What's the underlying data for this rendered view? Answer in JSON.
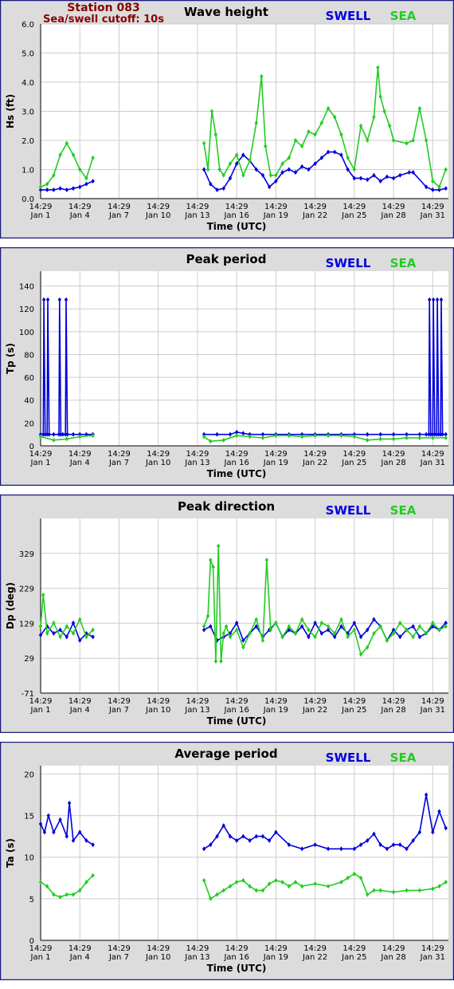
{
  "station": {
    "name": "Station 083",
    "cutoff": "Sea/swell cutoff: 10s",
    "color": "#8b0000"
  },
  "colors": {
    "swell": "#0000dd",
    "sea": "#22cc22",
    "frame": "#1a1a80",
    "panel_bg": "#dcdcdc",
    "grid": "#cccccc"
  },
  "time_axis": {
    "xlabel": "Time (UTC)",
    "tick_time": "14:29",
    "tick_days": [
      1,
      4,
      7,
      10,
      13,
      16,
      19,
      22,
      25,
      28,
      31
    ],
    "tick_dates": [
      "Jan 1",
      "Jan 4",
      "Jan 7",
      "Jan 10",
      "Jan 13",
      "Jan 16",
      "Jan 19",
      "Jan 22",
      "Jan 25",
      "Jan 28",
      "Jan 31"
    ],
    "xlim_days": [
      1,
      32.2
    ]
  },
  "chart_data": [
    {
      "type": "line",
      "title": "Wave height",
      "ylabel": "Hs (ft)",
      "ylim": [
        0,
        6
      ],
      "yticks": [
        "0.0",
        "1.0",
        "2.0",
        "3.0",
        "4.0",
        "5.0",
        "6.0"
      ],
      "grid": true,
      "legend": "top-right",
      "series": [
        {
          "name": "SWELL",
          "x": [
            1.0,
            1.5,
            2.0,
            2.5,
            3.0,
            3.5,
            4.0,
            4.5,
            5.0,
            13.5,
            14.0,
            14.5,
            15.0,
            15.5,
            16.0,
            16.5,
            17.0,
            17.5,
            18.0,
            18.5,
            19.0,
            19.5,
            20.0,
            20.5,
            21.0,
            21.5,
            22.0,
            22.5,
            23.0,
            23.5,
            24.0,
            24.5,
            25.0,
            25.5,
            26.0,
            26.5,
            27.0,
            27.5,
            28.0,
            28.5,
            29.2,
            29.5,
            30.5,
            31.0,
            31.5,
            32.0
          ],
          "y": [
            0.3,
            0.3,
            0.3,
            0.35,
            0.3,
            0.35,
            0.4,
            0.5,
            0.6,
            1.0,
            0.5,
            0.3,
            0.35,
            0.7,
            1.2,
            1.5,
            1.3,
            1.0,
            0.8,
            0.4,
            0.6,
            0.9,
            1.0,
            0.9,
            1.1,
            1.0,
            1.2,
            1.4,
            1.6,
            1.6,
            1.5,
            1.0,
            0.7,
            0.7,
            0.65,
            0.8,
            0.6,
            0.75,
            0.7,
            0.8,
            0.9,
            0.9,
            0.4,
            0.3,
            0.3,
            0.35
          ]
        },
        {
          "name": "SEA",
          "x": [
            1.0,
            1.5,
            2.0,
            2.5,
            3.0,
            3.5,
            4.0,
            4.5,
            5.0,
            13.5,
            13.8,
            14.1,
            14.4,
            14.7,
            15.0,
            15.5,
            16.0,
            16.5,
            17.0,
            17.5,
            17.9,
            18.2,
            18.6,
            19.0,
            19.5,
            20.0,
            20.5,
            21.0,
            21.5,
            22.0,
            22.5,
            23.0,
            23.5,
            24.0,
            24.5,
            25.0,
            25.5,
            26.0,
            26.5,
            26.8,
            27.0,
            27.3,
            27.7,
            28.0,
            29.0,
            29.5,
            30.0,
            30.5,
            31.0,
            31.5,
            32.0
          ],
          "y": [
            0.4,
            0.5,
            0.8,
            1.5,
            1.9,
            1.5,
            1.0,
            0.7,
            1.4,
            1.9,
            1.0,
            3.0,
            2.2,
            1.0,
            0.8,
            1.2,
            1.5,
            0.8,
            1.3,
            2.6,
            4.2,
            1.8,
            0.8,
            0.8,
            1.2,
            1.4,
            2.0,
            1.8,
            2.3,
            2.2,
            2.6,
            3.1,
            2.8,
            2.2,
            1.4,
            1.0,
            2.5,
            2.0,
            2.8,
            4.5,
            3.5,
            3.0,
            2.5,
            2.0,
            1.9,
            2.0,
            3.1,
            2.0,
            0.6,
            0.4,
            1.0
          ]
        }
      ]
    },
    {
      "type": "line",
      "title": "Peak period",
      "ylabel": "Tp (s)",
      "ylim": [
        0,
        153
      ],
      "yticks": [
        "0",
        "20",
        "40",
        "60",
        "80",
        "100",
        "120",
        "140"
      ],
      "grid": true,
      "legend": "top-right",
      "series": [
        {
          "name": "SWELL",
          "x": [
            1.0,
            1.2,
            1.25,
            1.35,
            1.5,
            1.55,
            1.65,
            2.0,
            2.4,
            2.45,
            2.55,
            2.7,
            2.9,
            2.95,
            3.05,
            3.5,
            4.0,
            4.5,
            5.0,
            13.5,
            14.5,
            15.5,
            16.0,
            16.5,
            17.0,
            18.0,
            19.0,
            20.0,
            21.0,
            22.0,
            23.0,
            24.0,
            25.0,
            26.0,
            27.0,
            28.0,
            29.0,
            30.0,
            30.5,
            30.7,
            30.75,
            30.85,
            31.0,
            31.05,
            31.15,
            31.3,
            31.35,
            31.45,
            31.6,
            31.65,
            31.75,
            32.0
          ],
          "y": [
            10,
            10,
            128,
            10,
            10,
            128,
            10,
            10,
            10,
            128,
            10,
            10,
            10,
            128,
            10,
            10,
            10,
            10,
            10,
            10,
            10,
            10,
            12,
            11,
            10,
            10,
            10,
            10,
            10,
            10,
            10,
            10,
            10,
            10,
            10,
            10,
            10,
            10,
            10,
            10,
            128,
            10,
            10,
            128,
            10,
            10,
            128,
            10,
            10,
            128,
            10,
            10
          ]
        },
        {
          "name": "SEA",
          "x": [
            1.0,
            2.0,
            3.0,
            4.0,
            5.0,
            13.5,
            14.0,
            15.0,
            16.0,
            17.0,
            18.0,
            19.0,
            20.0,
            21.0,
            22.0,
            23.0,
            24.0,
            25.0,
            26.0,
            27.0,
            28.0,
            29.0,
            30.0,
            31.0,
            32.0
          ],
          "y": [
            8,
            5,
            6,
            8,
            9,
            8,
            4,
            5,
            9,
            8,
            7,
            9,
            9,
            8,
            9,
            9,
            9,
            8,
            5,
            6,
            6,
            7,
            7,
            7,
            7
          ]
        }
      ]
    },
    {
      "type": "line",
      "title": "Peak direction",
      "ylabel": "Dp (deg)",
      "ylim": [
        -71,
        429
      ],
      "yticks": [
        "-71",
        "29",
        "129",
        "229",
        "329"
      ],
      "grid": true,
      "legend": "top-right",
      "series": [
        {
          "name": "SWELL",
          "x": [
            1.0,
            1.5,
            2.0,
            2.5,
            3.0,
            3.5,
            4.0,
            4.5,
            5.0,
            13.5,
            14.0,
            14.5,
            15.0,
            15.5,
            16.0,
            16.5,
            17.0,
            17.5,
            18.0,
            18.5,
            19.0,
            19.5,
            20.0,
            20.5,
            21.0,
            21.5,
            22.0,
            22.5,
            23.0,
            23.5,
            24.0,
            24.5,
            25.0,
            25.5,
            26.0,
            26.5,
            27.0,
            27.5,
            28.0,
            28.5,
            29.0,
            29.5,
            30.0,
            30.5,
            31.0,
            31.5,
            32.0
          ],
          "y": [
            95,
            120,
            100,
            110,
            90,
            130,
            80,
            100,
            90,
            110,
            120,
            80,
            90,
            100,
            130,
            80,
            100,
            120,
            90,
            110,
            130,
            90,
            110,
            100,
            120,
            90,
            130,
            100,
            110,
            90,
            120,
            100,
            130,
            90,
            110,
            140,
            120,
            80,
            110,
            90,
            110,
            120,
            90,
            100,
            120,
            110,
            130
          ]
        },
        {
          "name": "SEA",
          "x": [
            1.0,
            1.2,
            1.5,
            2.0,
            2.5,
            3.0,
            3.5,
            4.0,
            4.5,
            5.0,
            13.5,
            13.8,
            14.0,
            14.2,
            14.4,
            14.6,
            14.8,
            15.0,
            15.2,
            15.5,
            16.0,
            16.5,
            17.0,
            17.5,
            18.0,
            18.3,
            18.6,
            19.0,
            19.5,
            20.0,
            20.5,
            21.0,
            21.5,
            22.0,
            22.5,
            23.0,
            23.5,
            24.0,
            24.5,
            25.0,
            25.5,
            26.0,
            26.5,
            27.0,
            27.5,
            28.0,
            28.5,
            29.0,
            29.5,
            30.0,
            30.5,
            31.0,
            31.5,
            32.0
          ],
          "y": [
            120,
            210,
            100,
            130,
            90,
            120,
            100,
            140,
            90,
            110,
            120,
            150,
            310,
            290,
            20,
            350,
            20,
            100,
            120,
            90,
            110,
            60,
            100,
            140,
            80,
            310,
            110,
            130,
            90,
            120,
            100,
            140,
            110,
            90,
            130,
            120,
            100,
            140,
            90,
            110,
            40,
            60,
            100,
            120,
            80,
            100,
            130,
            110,
            90,
            120,
            100,
            130,
            110,
            120
          ]
        }
      ]
    },
    {
      "type": "line",
      "title": "Average period",
      "ylabel": "Ta (s)",
      "ylim": [
        0,
        21
      ],
      "yticks": [
        "0",
        "5",
        "10",
        "15",
        "20"
      ],
      "grid": true,
      "legend": "top-right",
      "series": [
        {
          "name": "SWELL",
          "x": [
            1.0,
            1.3,
            1.6,
            2.0,
            2.5,
            3.0,
            3.2,
            3.5,
            4.0,
            4.5,
            5.0,
            13.5,
            14.0,
            14.5,
            15.0,
            15.5,
            16.0,
            16.5,
            17.0,
            17.5,
            18.0,
            18.5,
            19.0,
            20.0,
            21.0,
            22.0,
            23.0,
            24.0,
            25.0,
            25.5,
            26.0,
            26.5,
            27.0,
            27.5,
            28.0,
            28.5,
            29.0,
            29.5,
            30.0,
            30.5,
            31.0,
            31.5,
            32.0
          ],
          "y": [
            14.0,
            13.0,
            15.0,
            13.0,
            14.5,
            12.5,
            16.5,
            12.0,
            13.0,
            12.0,
            11.5,
            11.0,
            11.5,
            12.5,
            13.8,
            12.5,
            12.0,
            12.5,
            12.0,
            12.5,
            12.5,
            12.0,
            13.0,
            11.5,
            11.0,
            11.5,
            11.0,
            11.0,
            11.0,
            11.5,
            12.0,
            12.8,
            11.5,
            11.0,
            11.5,
            11.5,
            11.0,
            12.0,
            13.0,
            17.5,
            13.0,
            15.5,
            13.5
          ]
        },
        {
          "name": "SEA",
          "x": [
            1.0,
            1.5,
            2.0,
            2.5,
            3.0,
            3.5,
            4.0,
            4.5,
            5.0,
            13.5,
            14.0,
            14.5,
            15.0,
            15.5,
            16.0,
            16.5,
            17.0,
            17.5,
            18.0,
            18.5,
            19.0,
            19.5,
            20.0,
            20.5,
            21.0,
            22.0,
            23.0,
            24.0,
            24.5,
            25.0,
            25.5,
            26.0,
            26.5,
            27.0,
            28.0,
            29.0,
            30.0,
            31.0,
            31.5,
            32.0
          ],
          "y": [
            7.0,
            6.5,
            5.5,
            5.2,
            5.5,
            5.5,
            6.0,
            7.0,
            7.8,
            7.2,
            5.0,
            5.5,
            6.0,
            6.5,
            7.0,
            7.2,
            6.5,
            6.0,
            6.0,
            6.8,
            7.2,
            7.0,
            6.5,
            7.0,
            6.5,
            6.8,
            6.5,
            7.0,
            7.5,
            8.0,
            7.5,
            5.5,
            6.0,
            6.0,
            5.8,
            6.0,
            6.0,
            6.2,
            6.5,
            7.0
          ]
        }
      ]
    }
  ]
}
